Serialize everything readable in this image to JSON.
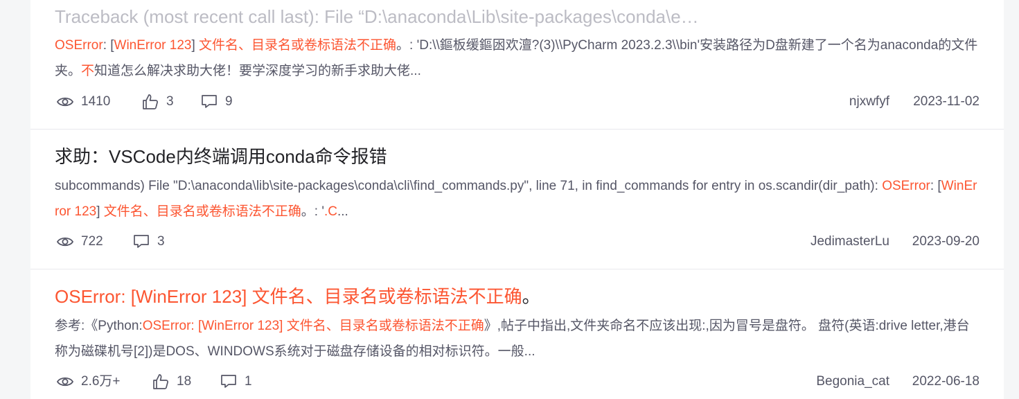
{
  "items": [
    {
      "title": "Traceback (most recent call last): File “D:\\anaconda\\Lib\\site-packages\\conda\\e…",
      "desc": [
        {
          "t": "OSError",
          "hl": true
        },
        {
          "t": ": [",
          "hl": false
        },
        {
          "t": "WinError 123",
          "hl": true
        },
        {
          "t": "] ",
          "hl": false
        },
        {
          "t": "文件名、目录名或卷标语法不正确",
          "hl": true
        },
        {
          "t": "。: 'D:\\\\鏂板缓鏂囦欢澶?(3)\\\\PyCharm 2023.2.3\\\\bin'安装路径为D盘新建了一个名为anaconda的文件夹。",
          "hl": false
        },
        {
          "t": "不",
          "hl": true
        },
        {
          "t": "知道怎么解决求助大佬！要学深度学习的新手求助大佬...",
          "hl": false
        }
      ],
      "views": "1410",
      "likes": "3",
      "comments": "9",
      "author": "njxwfyf",
      "date": "2023-11-02"
    },
    {
      "title": "求助：VSCode内终端调用conda命令报错",
      "desc": [
        {
          "t": "subcommands) File \"D:\\anaconda\\lib\\site-packages\\conda\\cli\\find_commands.py\", line 71, in find_commands for entry in os.scandir(dir_path): ",
          "hl": false
        },
        {
          "t": "OSError",
          "hl": true
        },
        {
          "t": ": [",
          "hl": false
        },
        {
          "t": "WinError 123",
          "hl": true
        },
        {
          "t": "] ",
          "hl": false
        },
        {
          "t": "文件名、目录名或卷标语法不正确",
          "hl": true
        },
        {
          "t": "。: '",
          "hl": false
        },
        {
          "t": ".C",
          "hl": true
        },
        {
          "t": "...",
          "hl": false
        }
      ],
      "views": "722",
      "comments": "3",
      "author": "JedimasterLu",
      "date": "2023-09-20"
    },
    {
      "title_hl": "OSError: [WinError 123] 文件名、目录名或卷标语法不正确",
      "title_rest": "。",
      "desc": [
        {
          "t": "参考:《Python:",
          "hl": false
        },
        {
          "t": "OSError: [WinError 123] 文件名、目录名或卷标语法不正确",
          "hl": true
        },
        {
          "t": "》,帖子中指出,文件夹命名不应该出现:,因为冒号是盘符。 盘符(英语:drive letter,港台称为磁碟机号[2])是DOS、WINDOWS系统对于磁盘存储设备的相对标识符。一般...",
          "hl": false
        }
      ],
      "views": "2.6万+",
      "likes": "18",
      "comments": "1",
      "author": "Begonia_cat",
      "date": "2022-06-18"
    }
  ],
  "icons": {
    "views": "eye-icon",
    "likes": "thumbs-up-icon",
    "comments": "comment-icon"
  },
  "colors": {
    "highlight": "#fc5531",
    "text": "#222226",
    "muted": "#555666",
    "faded_title": "#bcbcc4"
  }
}
